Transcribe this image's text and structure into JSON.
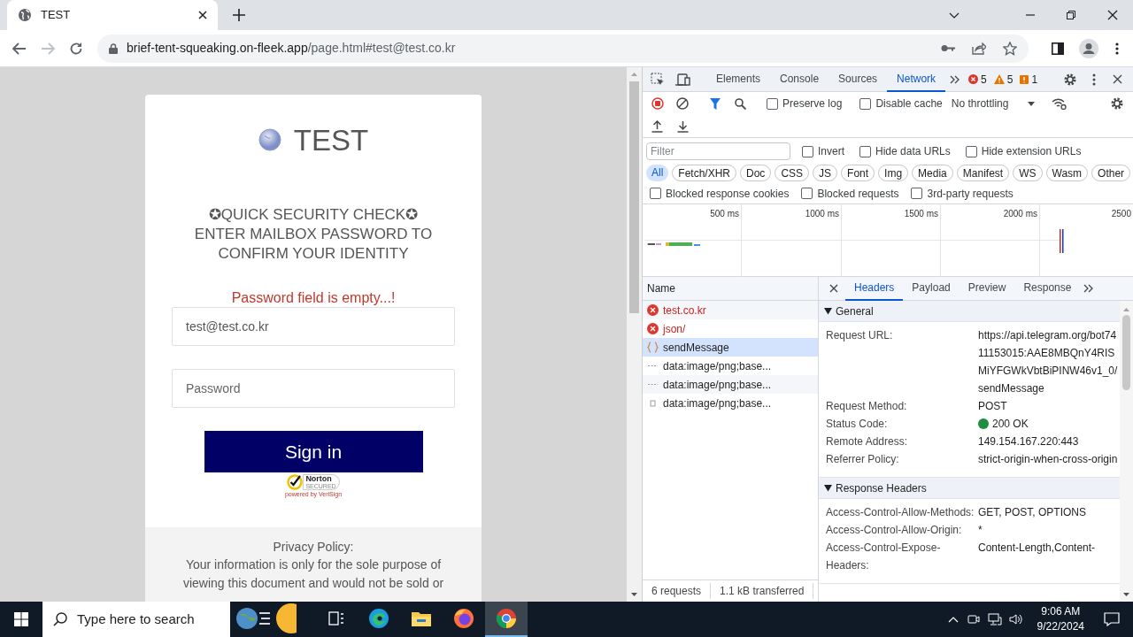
{
  "browser": {
    "tab": {
      "title": "TEST"
    },
    "url": {
      "host": "brief-tent-squeaking.on-fleek.app",
      "path": "/page.html#test@test.co.kr"
    },
    "forward_disabled": true
  },
  "page": {
    "brand": "TEST",
    "heading_lines": [
      "✪QUICK SECURITY CHECK✪",
      "ENTER MAILBOX PASSWORD TO",
      "CONFIRM YOUR IDENTITY"
    ],
    "error": "Password field is empty...!",
    "email": {
      "value": "test@test.co.kr"
    },
    "password": {
      "placeholder": "Password"
    },
    "sign_in": "Sign in",
    "seal": {
      "name": "Norton",
      "sub": "SECURED",
      "powered": "powered by VeriSign"
    },
    "privacy": {
      "title": "Privacy Policy:",
      "text": "Your information is only for the sole purpose of viewing this document and would not be sold or"
    }
  },
  "devtools": {
    "tabs": [
      {
        "label": "Elements",
        "selected": false
      },
      {
        "label": "Console",
        "selected": false
      },
      {
        "label": "Sources",
        "selected": false
      },
      {
        "label": "Network",
        "selected": true
      }
    ],
    "counts": [
      {
        "kind": "error",
        "count": "5"
      },
      {
        "kind": "warning",
        "count": "5"
      },
      {
        "kind": "info",
        "count": "1"
      }
    ],
    "toolbar": {
      "recording": true,
      "filter_active": true,
      "preserve_log": {
        "label": "Preserve log",
        "checked": false
      },
      "disable_cache": {
        "label": "Disable cache",
        "checked": false
      },
      "throttling": "No throttling"
    },
    "filter": {
      "placeholder": "Filter",
      "options": [
        {
          "label": "Invert",
          "checked": false
        },
        {
          "label": "Hide data URLs",
          "checked": false
        },
        {
          "label": "Hide extension URLs",
          "checked": false
        }
      ]
    },
    "types": [
      {
        "label": "All",
        "selected": true
      },
      {
        "label": "Fetch/XHR",
        "selected": false
      },
      {
        "label": "Doc",
        "selected": false
      },
      {
        "label": "CSS",
        "selected": false
      },
      {
        "label": "JS",
        "selected": false
      },
      {
        "label": "Font",
        "selected": false
      },
      {
        "label": "Img",
        "selected": false
      },
      {
        "label": "Media",
        "selected": false
      },
      {
        "label": "Manifest",
        "selected": false
      },
      {
        "label": "WS",
        "selected": false
      },
      {
        "label": "Wasm",
        "selected": false
      },
      {
        "label": "Other",
        "selected": false
      }
    ],
    "more_options": [
      {
        "label": "Blocked response cookies",
        "checked": false
      },
      {
        "label": "Blocked requests",
        "checked": false
      },
      {
        "label": "3rd-party requests",
        "checked": false
      }
    ],
    "overview": {
      "ticks": [
        "500 ms",
        "1000 ms",
        "1500 ms",
        "2000 ms",
        "2500"
      ]
    },
    "requests": {
      "column": "Name",
      "rows": [
        {
          "name": "test.co.kr",
          "kind": "error",
          "selected": false
        },
        {
          "name": "json/",
          "kind": "error",
          "selected": false
        },
        {
          "name": "sendMessage",
          "kind": "fetch",
          "selected": true
        },
        {
          "name": "data:image/png;base...",
          "kind": "data",
          "selected": false
        },
        {
          "name": "data:image/png;base...",
          "kind": "data",
          "selected": false
        },
        {
          "name": "data:image/png;base...",
          "kind": "image",
          "selected": false
        }
      ],
      "summary": [
        "6 requests",
        "1.1 kB transferred"
      ]
    },
    "details": {
      "tabs": [
        {
          "label": "Headers",
          "selected": true
        },
        {
          "label": "Payload",
          "selected": false
        },
        {
          "label": "Preview",
          "selected": false
        },
        {
          "label": "Response",
          "selected": false
        }
      ],
      "sections": [
        {
          "title": "General",
          "expanded": true,
          "rows": [
            {
              "name": "Request URL:",
              "value": "https://api.telegram.org/bot7411153015:AAE8MBQnY4RISMiYFGWkVbtBiPINW46v1_0/sendMessage",
              "kind": "text"
            },
            {
              "name": "Request Method:",
              "value": "POST",
              "kind": "text"
            },
            {
              "name": "Status Code:",
              "value": "200 OK",
              "kind": "status"
            },
            {
              "name": "Remote Address:",
              "value": "149.154.167.220:443",
              "kind": "text"
            },
            {
              "name": "Referrer Policy:",
              "value": "strict-origin-when-cross-origin",
              "kind": "text"
            }
          ]
        },
        {
          "title": "Response Headers",
          "expanded": true,
          "rows": [
            {
              "name": "Access-Control-Allow-Methods:",
              "value": "GET, POST, OPTIONS",
              "kind": "text"
            },
            {
              "name": "Access-Control-Allow-Origin:",
              "value": "*",
              "kind": "text"
            },
            {
              "name": "Access-Control-Expose-Headers:",
              "value": "Content-Length,Content-",
              "kind": "text"
            }
          ]
        }
      ]
    }
  },
  "taskbar": {
    "search_placeholder": "Type here to search",
    "apps": [
      {
        "kind": "news",
        "selected": false
      },
      {
        "kind": "taskview",
        "selected": false
      },
      {
        "kind": "edge",
        "selected": false
      },
      {
        "kind": "explorer",
        "selected": false
      },
      {
        "kind": "firefox",
        "selected": false
      },
      {
        "kind": "chrome",
        "selected": true
      }
    ],
    "time": "9:06 AM",
    "date": "9/22/2024"
  }
}
